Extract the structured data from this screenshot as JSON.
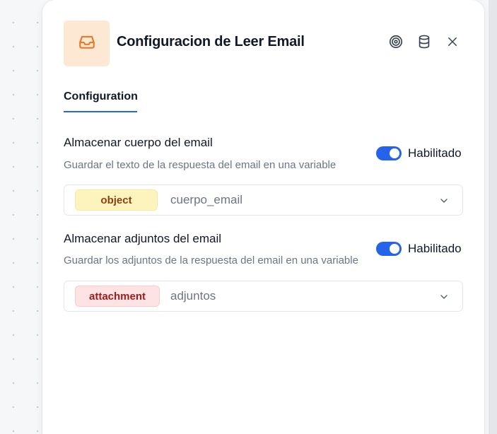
{
  "panel": {
    "title": "Configuracion de Leer Email",
    "header_icon": "inbox-icon",
    "actions": [
      "target-icon",
      "database-icon",
      "close-icon"
    ]
  },
  "tabs": [
    {
      "label": "Configuration",
      "active": true
    }
  ],
  "sections": [
    {
      "label": "Almacenar cuerpo del email",
      "description": "Guardar el texto de la respuesta del email en una variable",
      "toggle": {
        "enabled": true,
        "label": "Habilitado"
      },
      "select": {
        "type_badge": "object",
        "value": "cuerpo_email"
      }
    },
    {
      "label": "Almacenar adjuntos del email",
      "description": "Guardar los adjuntos de la respuesta del email en una variable",
      "toggle": {
        "enabled": true,
        "label": "Habilitado"
      },
      "select": {
        "type_badge": "attachment",
        "value": "adjuntos"
      }
    }
  ],
  "colors": {
    "accent": "#2563eb",
    "icon_bg": "#fde8d4",
    "icon_stroke": "#ea7a2a",
    "object_badge_bg": "#fdf4bd",
    "attachment_badge_bg": "#fde3e3"
  }
}
